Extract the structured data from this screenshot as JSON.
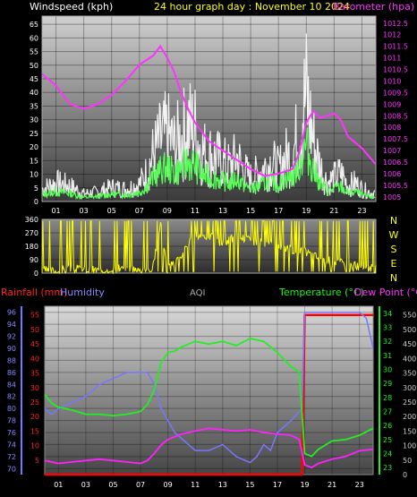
{
  "header": {
    "windspeed_label": "Windspeed (kph)",
    "title": "24 hour graph day : November 10 2024",
    "barometer_label": "Barometer (hpa)"
  },
  "direction_labels": [
    "N",
    "W",
    "S",
    "E",
    "N"
  ],
  "lower_header": {
    "rainfall_label": "Rainfall (mm)",
    "humidity_label": "Humidity",
    "aqi_label": "AQI",
    "temperature_label": "Temperature (°C)",
    "dewpoint_label": "Dew Point (°C)"
  },
  "colors": {
    "windspeed": "#ffffff",
    "gust": "#55ff55",
    "barometer": "#ff33ff",
    "direction": "#ffff00",
    "rainfall": "#ff0000",
    "humidity": "#7777ff",
    "aqi": "#aaaaaa",
    "temperature": "#22ee22",
    "dewpoint": "#ff22ff"
  },
  "chart_data": [
    {
      "type": "line",
      "title": "24 hour graph day : November 10 2024",
      "xlabel": "",
      "x_ticks": [
        "01",
        "03",
        "05",
        "07",
        "09",
        "11",
        "13",
        "15",
        "17",
        "19",
        "21",
        "23"
      ],
      "xlim": [
        0,
        24
      ],
      "grid": true,
      "left_axis": {
        "label": "Windspeed (kph)",
        "ticks": [
          0,
          5,
          10,
          15,
          20,
          25,
          30,
          35,
          40,
          45,
          50,
          55,
          60,
          65
        ],
        "range": [
          0,
          68
        ]
      },
      "right_axis": {
        "label": "Barometer (hpa)",
        "ticks": [
          1005,
          1005.5,
          1006,
          1006.5,
          1007,
          1007.5,
          1008,
          1008.5,
          1009,
          1009.5,
          1010,
          1010.5,
          1011,
          1011.5,
          1012,
          1012.5
        ],
        "range": [
          1004.8,
          1012.8
        ]
      },
      "series": [
        {
          "name": "Windspeed (kph)",
          "axis": "left",
          "x": [
            0,
            1,
            2,
            3,
            4,
            5,
            6,
            7,
            7.5,
            8,
            8.5,
            9,
            9.5,
            10,
            10.5,
            11,
            11.5,
            12,
            12.5,
            13,
            13.5,
            14,
            14.5,
            15,
            15.5,
            16,
            16.5,
            17,
            17.5,
            18,
            18.5,
            18.8,
            19,
            19.3,
            19.6,
            20,
            20.5,
            21,
            21.5,
            22,
            22.5,
            23,
            23.5,
            24
          ],
          "values": [
            8,
            12,
            10,
            5,
            6,
            9,
            8,
            11,
            18,
            30,
            38,
            42,
            35,
            40,
            48,
            45,
            32,
            30,
            28,
            25,
            22,
            28,
            20,
            15,
            18,
            22,
            25,
            20,
            28,
            30,
            45,
            60,
            68,
            50,
            35,
            22,
            12,
            15,
            18,
            10,
            12,
            8,
            6,
            5
          ]
        },
        {
          "name": "Barometer (hpa)",
          "axis": "right",
          "x": [
            0,
            1,
            2,
            3,
            4,
            5,
            6,
            7,
            8,
            8.5,
            9,
            9.5,
            10,
            10.5,
            11,
            12,
            13,
            14,
            15,
            16,
            17,
            18,
            18.5,
            19,
            19.5,
            20,
            21,
            21.5,
            22,
            23,
            24
          ],
          "values": [
            1010.3,
            1009.8,
            1009.0,
            1008.8,
            1009.0,
            1009.4,
            1010.0,
            1010.7,
            1011.1,
            1011.5,
            1011.0,
            1010.4,
            1009.5,
            1008.8,
            1008.2,
            1007.4,
            1007.0,
            1006.6,
            1006.2,
            1005.9,
            1006.0,
            1006.2,
            1006.9,
            1008.2,
            1008.7,
            1008.4,
            1008.6,
            1008.3,
            1007.6,
            1007.1,
            1006.4
          ]
        }
      ]
    },
    {
      "type": "line",
      "title": "",
      "x_ticks": [],
      "xlim": [
        0,
        24
      ],
      "left_axis": {
        "label": "",
        "ticks": [
          0,
          90,
          180,
          270,
          360
        ],
        "range": [
          0,
          360
        ]
      },
      "right_axis": {
        "label": "",
        "ticks": [
          "N",
          "W",
          "S",
          "E",
          "N"
        ]
      },
      "series": [
        {
          "name": "",
          "axis": "left",
          "x": [
            0,
            1,
            2,
            3,
            4,
            5,
            6,
            7,
            8,
            8.5,
            9,
            10,
            11,
            12,
            13,
            14,
            15,
            16,
            17,
            18,
            19,
            20,
            21,
            22,
            23,
            24
          ],
          "values": [
            20,
            15,
            30,
            25,
            20,
            30,
            25,
            20,
            40,
            350,
            20,
            120,
            260,
            250,
            200,
            250,
            220,
            200,
            180,
            160,
            140,
            100,
            80,
            60,
            40,
            30
          ]
        }
      ]
    },
    {
      "type": "line",
      "title": "",
      "x_ticks": [
        "01",
        "03",
        "05",
        "07",
        "09",
        "11",
        "13",
        "15",
        "17",
        "19",
        "21",
        "23"
      ],
      "xlim": [
        0,
        24
      ],
      "grid": true,
      "left_axis_outer": {
        "label": "Humidity",
        "ticks": [
          70,
          72,
          74,
          76,
          78,
          80,
          82,
          84,
          86,
          88,
          90,
          92,
          94,
          96
        ],
        "range": [
          69,
          97
        ]
      },
      "left_axis_inner": {
        "label": "Rainfall (mm)",
        "ticks": [
          5,
          10,
          15,
          20,
          25,
          30,
          35,
          40,
          45,
          50,
          55
        ],
        "range": [
          0,
          58
        ]
      },
      "right_axis_inner": {
        "label": "Temperature (°C)",
        "ticks": [
          23,
          24,
          25,
          26,
          27,
          28,
          29,
          30,
          31,
          32,
          33,
          34
        ],
        "range": [
          22.5,
          34.5
        ]
      },
      "right_axis_outer": {
        "label": "AQI",
        "ticks": [
          0,
          50,
          100,
          150,
          200,
          250,
          300,
          350,
          400,
          450,
          500,
          550
        ],
        "range": [
          0,
          580
        ]
      },
      "series": [
        {
          "name": "Rainfall (mm)",
          "axis": "left_inner",
          "x": [
            0,
            18.8,
            19,
            24
          ],
          "values": [
            0,
            0,
            55,
            55
          ]
        },
        {
          "name": "Humidity",
          "axis": "left_outer",
          "x": [
            0,
            0.5,
            1,
            2,
            3,
            4,
            5,
            6,
            7,
            7.5,
            8,
            8.5,
            9,
            9.5,
            10,
            11,
            12,
            13,
            14,
            15,
            15.5,
            16,
            16.5,
            17,
            18,
            18.8,
            19,
            20,
            21,
            22,
            23,
            23.5,
            24
          ],
          "values": [
            80,
            79,
            80,
            81,
            82,
            84,
            85,
            86,
            86,
            86,
            84,
            80,
            78,
            76,
            75,
            73,
            73,
            74,
            72,
            71,
            72,
            74,
            73,
            76,
            78,
            80,
            96,
            96,
            96,
            96,
            96,
            95,
            90
          ]
        },
        {
          "name": "Temperature (°C)",
          "axis": "right_inner",
          "x": [
            0,
            0.5,
            1,
            2,
            3,
            4,
            5,
            6,
            7,
            7.5,
            8,
            8.5,
            9,
            9.5,
            10,
            11,
            12,
            13,
            14,
            15,
            16,
            17,
            18,
            18.6,
            19,
            19.5,
            20,
            21,
            22,
            23,
            24
          ],
          "values": [
            28.2,
            27.6,
            27.3,
            27.1,
            26.8,
            26.8,
            26.7,
            26.8,
            27.0,
            27.5,
            28.5,
            30.5,
            31.2,
            31.3,
            31.6,
            32.0,
            31.8,
            32.0,
            31.7,
            32.2,
            32.0,
            31.2,
            30.2,
            29.8,
            24.0,
            23.8,
            24.3,
            24.9,
            25.0,
            25.3,
            25.8
          ]
        },
        {
          "name": "Dew Point (°C)",
          "axis": "right_inner",
          "x": [
            0,
            1,
            2,
            3,
            4,
            5,
            6,
            7,
            7.5,
            8,
            8.5,
            9,
            10,
            11,
            12,
            13,
            14,
            15,
            16,
            17,
            18,
            18.6,
            19,
            19.5,
            20,
            21,
            22,
            23,
            24
          ],
          "values": [
            23.5,
            23.3,
            23.4,
            23.5,
            23.6,
            23.5,
            23.4,
            23.3,
            23.5,
            24.0,
            24.6,
            25.0,
            25.4,
            25.6,
            25.8,
            25.7,
            25.6,
            25.7,
            25.5,
            25.4,
            25.3,
            25.0,
            23.2,
            23.0,
            23.3,
            23.6,
            23.8,
            24.2,
            24.3
          ]
        }
      ]
    }
  ]
}
